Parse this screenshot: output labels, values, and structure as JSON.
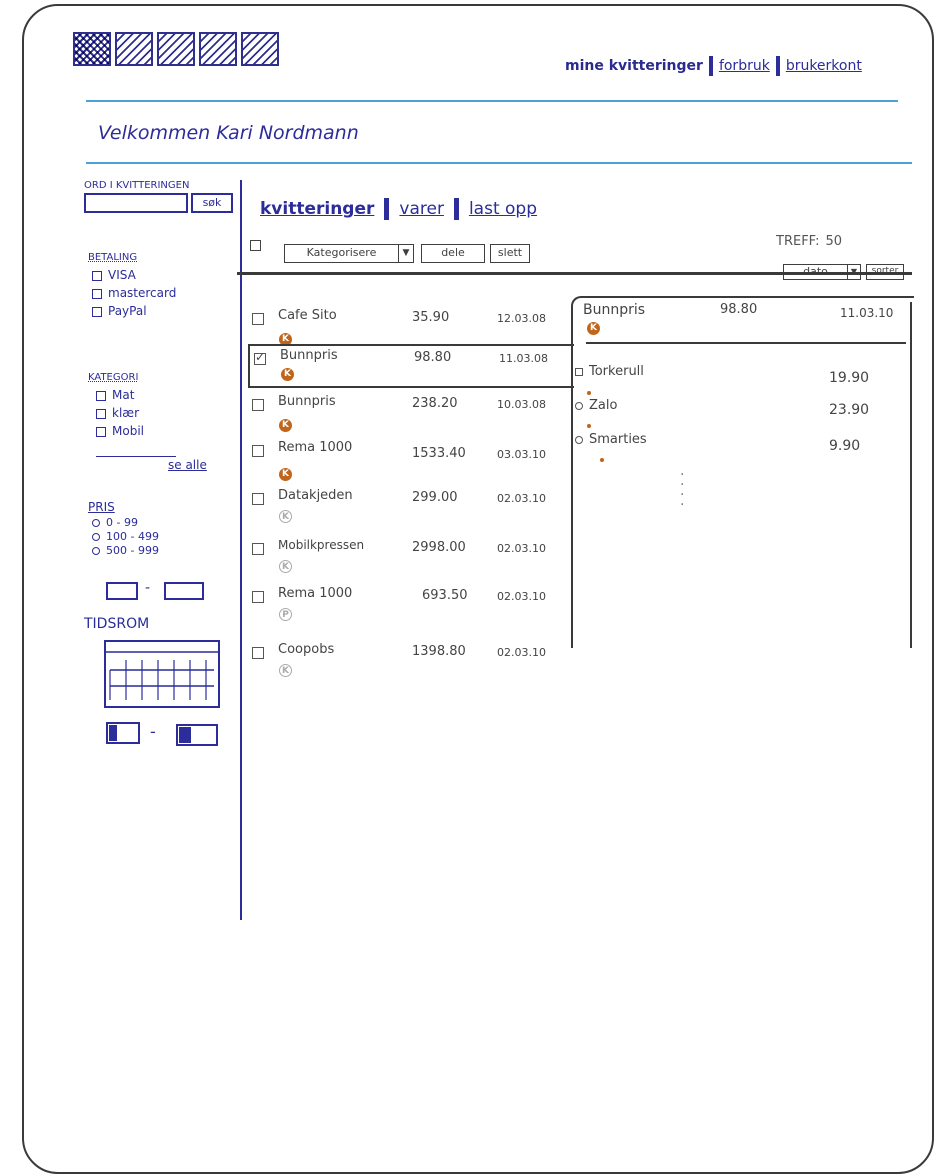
{
  "nav": {
    "items": [
      {
        "label": "mine kvitteringer",
        "active": true
      },
      {
        "label": "forbruk",
        "active": false
      },
      {
        "label": "brukerkont",
        "active": false
      }
    ]
  },
  "welcome": "Velkommen Kari Nordmann",
  "sidebar": {
    "search_label": "ORD I KVITTERINGEN",
    "search_value": "",
    "search_button": "søk",
    "betaling_title": "BETALING",
    "betaling_options": [
      "VISA",
      "mastercard",
      "PayPal"
    ],
    "kategori_title": "KATEGORI",
    "kategori_options": [
      "Mat",
      "klær",
      "Mobil"
    ],
    "se_alle": "se alle",
    "pris_title": "PRIS",
    "pris_options": [
      "0 - 99",
      "100 - 499",
      "500 - 999"
    ],
    "pris_range_sep": "-",
    "tidsrom_title": "TIDSROM",
    "date_range_sep": "-"
  },
  "tabs": [
    {
      "label": "kvitteringer",
      "active": true
    },
    {
      "label": "varer",
      "active": false
    },
    {
      "label": "last opp",
      "active": false
    }
  ],
  "toolbar": {
    "kategorisere": "Kategorisere",
    "dele": "dele",
    "slett": "slett",
    "treff_label": "TREFF:",
    "treff_value": "50",
    "sort_value": "dato",
    "sort_button": "sorter"
  },
  "receipts": [
    {
      "name": "Cafe Sito",
      "amount": "35.90",
      "date": "12.03.08",
      "badge": "K",
      "checked": false,
      "badge_filled": true
    },
    {
      "name": "Bunnpris",
      "amount": "98.80",
      "date": "11.03.08",
      "badge": "K",
      "checked": true,
      "badge_filled": true
    },
    {
      "name": "Bunnpris",
      "amount": "238.20",
      "date": "10.03.08",
      "badge": "K",
      "checked": false,
      "badge_filled": true
    },
    {
      "name": "Rema 1000",
      "amount": "1533.40",
      "date": "03.03.10",
      "badge": "K",
      "checked": false,
      "badge_filled": true
    },
    {
      "name": "Datakjeden",
      "amount": "299.00",
      "date": "02.03.10",
      "badge": "K",
      "checked": false,
      "badge_filled": false
    },
    {
      "name": "Mobilkpressen",
      "amount": "2998.00",
      "date": "02.03.10",
      "badge": "K",
      "checked": false,
      "badge_filled": false
    },
    {
      "name": "Rema 1000",
      "amount": "693.50",
      "date": "02.03.10",
      "badge": "P",
      "checked": false,
      "badge_filled": false
    },
    {
      "name": "Coopobs",
      "amount": "1398.80",
      "date": "02.03.10",
      "badge": "K",
      "checked": false,
      "badge_filled": false
    }
  ],
  "detail": {
    "name": "Bunnpris",
    "amount": "98.80",
    "date": "11.03.10",
    "badge": "K",
    "items": [
      {
        "name": "Torkerull",
        "price": "19.90"
      },
      {
        "name": "Zalo",
        "price": "23.90"
      },
      {
        "name": "Smarties",
        "price": "9.90"
      }
    ]
  },
  "colors": {
    "ink_blue": "#2c2c9a",
    "accent_line": "#4aa3d4",
    "badge": "#c0651c"
  }
}
